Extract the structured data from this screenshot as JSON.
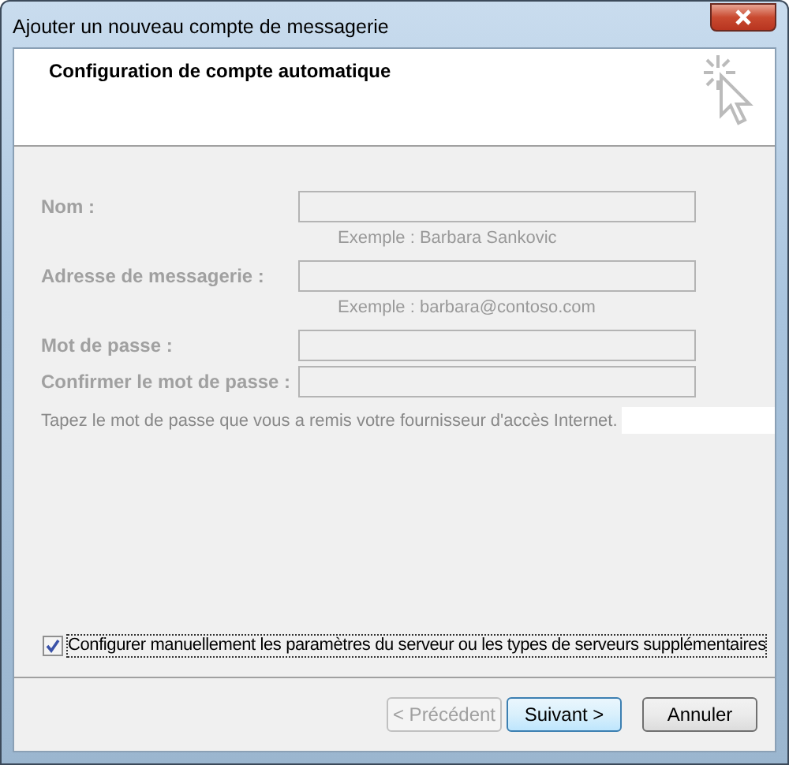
{
  "window": {
    "title": "Ajouter un nouveau compte de messagerie"
  },
  "header": {
    "title": "Configuration de compte automatique"
  },
  "fields": [
    {
      "label": "Nom :",
      "example": "Exemple : Barbara Sankovic",
      "disabled": true
    },
    {
      "label": "Adresse de messagerie :",
      "example": "Exemple : barbara@contoso.com",
      "disabled": true
    },
    {
      "label": "Mot de passe :",
      "disabled": true
    },
    {
      "label": "Confirmer le mot de passe :",
      "disabled": true
    }
  ],
  "password_hint": "Tapez le mot de passe que vous a remis votre fournisseur d'accès Internet.",
  "manual_config": {
    "label": "Configurer manuellement les paramètres du serveur ou les types de serveurs supplémentaires",
    "checked": true
  },
  "buttons": [
    {
      "label": "< Précédent",
      "disabled": true,
      "default": false
    },
    {
      "label": "Suivant >",
      "disabled": false,
      "default": true
    },
    {
      "label": "Annuler",
      "disabled": false,
      "default": false
    }
  ]
}
